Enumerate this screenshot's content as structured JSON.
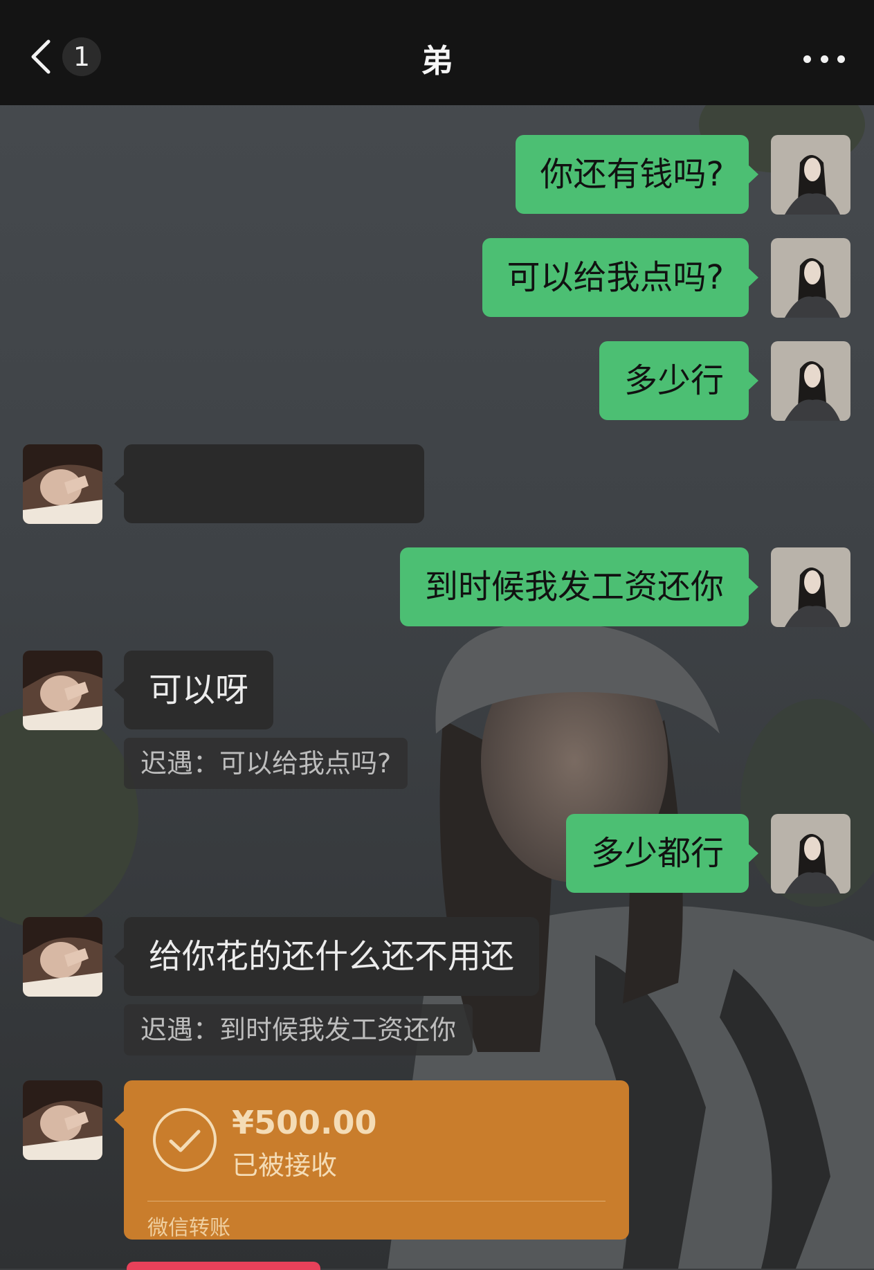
{
  "header": {
    "back_badge": "1",
    "title": "弟",
    "back_icon": "chevron-left-icon",
    "more_icon": "more-dots-icon"
  },
  "messages": [
    {
      "from": "me",
      "text": "你还有钱吗?"
    },
    {
      "from": "me",
      "text": "可以给我点吗?"
    },
    {
      "from": "me",
      "text": "多少行"
    },
    {
      "from": "them",
      "text": ""
    },
    {
      "from": "me",
      "text": "到时候我发工资还你"
    },
    {
      "from": "them",
      "text": "可以呀",
      "quote": "迟遇：可以给我点吗?"
    },
    {
      "from": "me",
      "text": "多少都行"
    },
    {
      "from": "them",
      "text": "给你花的还什么还不用还",
      "quote": "迟遇：到时候我发工资还你"
    }
  ],
  "transfer": {
    "amount": "¥500.00",
    "status": "已被接收",
    "label": "微信转账",
    "icon": "check-circle-icon"
  },
  "colors": {
    "topbar": "#141414",
    "my_bubble": "#4cbf73",
    "their_bubble": "#2c2c2c",
    "transfer_card": "#c97d2c"
  }
}
